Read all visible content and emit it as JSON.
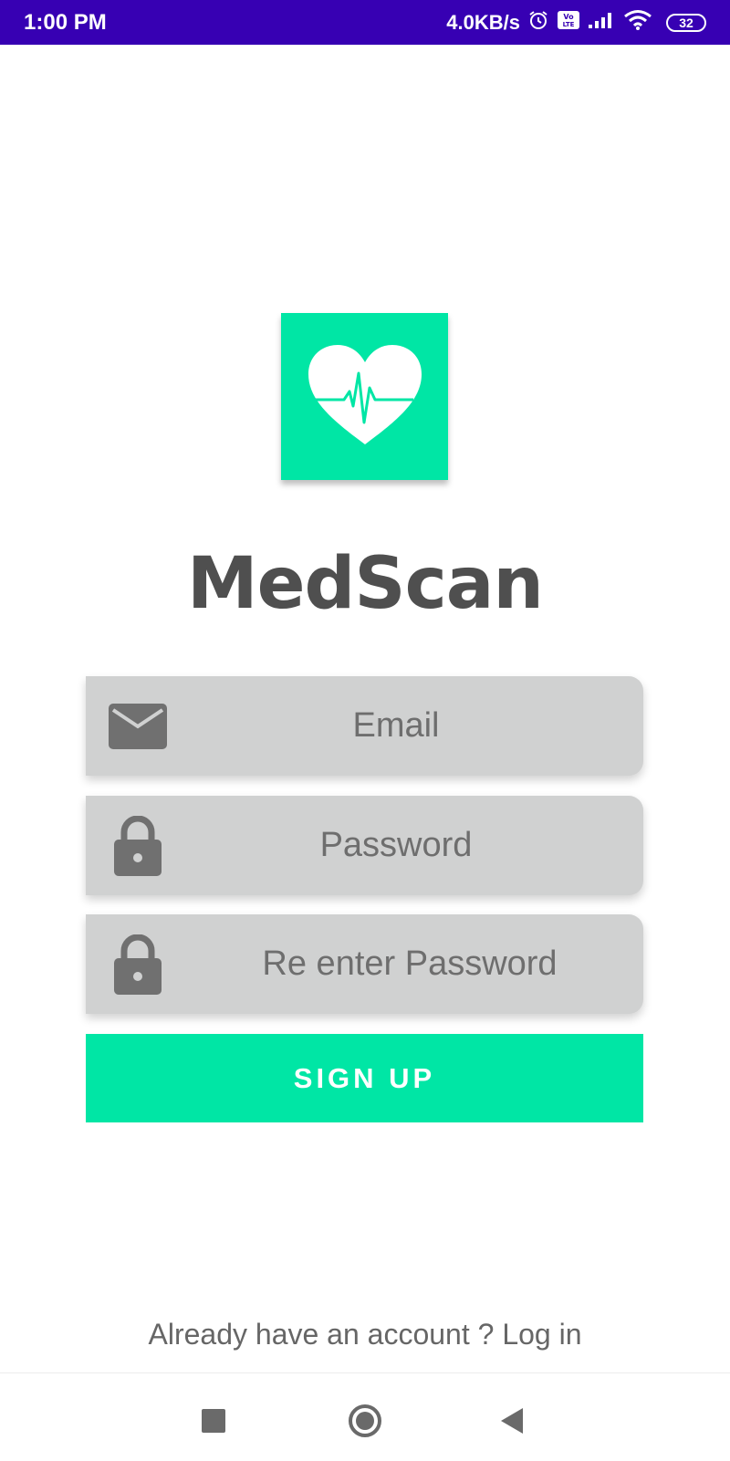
{
  "status_bar": {
    "time": "1:00 PM",
    "network_speed": "4.0KB/s",
    "battery_level": "32",
    "icons": [
      "alarm-icon",
      "volte-icon",
      "signal-icon",
      "wifi-icon",
      "battery-icon"
    ]
  },
  "app": {
    "name": "MedScan",
    "logo_icon": "heart-pulse-icon",
    "accent_color": "#00e6a5"
  },
  "form": {
    "email": {
      "placeholder": "Email",
      "value": "",
      "icon": "email-icon"
    },
    "password": {
      "placeholder": "Password",
      "value": "",
      "icon": "lock-icon"
    },
    "reenter_password": {
      "placeholder": "Re enter Password",
      "value": "",
      "icon": "lock-icon"
    },
    "signup_label": "SIGN UP"
  },
  "footer": {
    "login_prompt": "Already have an account ? Log in"
  },
  "nav_bar": {
    "buttons": [
      "recents-icon",
      "home-icon",
      "back-icon"
    ]
  }
}
